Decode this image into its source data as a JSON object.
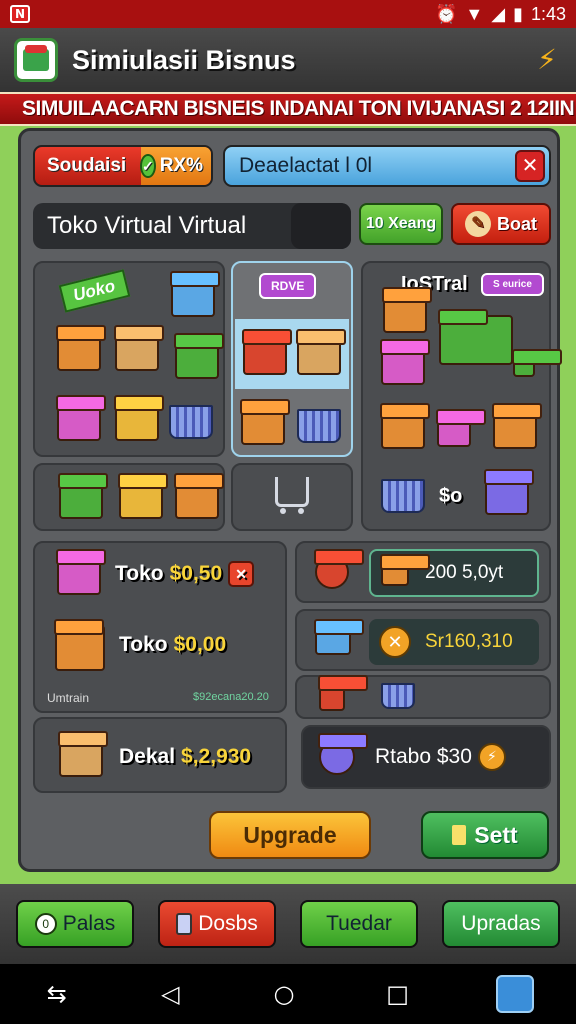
{
  "status_bar": {
    "time": "1:43",
    "icons": [
      "alarm-icon",
      "wifi-icon",
      "signal-icon",
      "battery-icon"
    ]
  },
  "header": {
    "title": "Simiulasii Bisnus",
    "banner": "SIMUILAACARN BISNEIS INDANAI TON IVIJANASI 2 12IIN"
  },
  "toolbar": {
    "red_pill_label": "Soudaisi",
    "red_pill_value": "RX%",
    "blue_field_value": "Deaelactat l 0l",
    "search_value": "Toko Virtual Virtual",
    "green_button": "10 Xeang",
    "red_button": "Boat"
  },
  "grid": {
    "ribbon_label": "Uoko",
    "sign_center": "RDVE",
    "label_right": "IoSTral",
    "sign_right": "S eurice",
    "price_small": "$o"
  },
  "lists": {
    "row1": {
      "name": "Toko",
      "amount": "$0,50"
    },
    "row2": {
      "name": "Toko",
      "amount": "$0,00"
    },
    "footer_left": "Umtrain",
    "footer_right": "$92ecana20.20",
    "row3": {
      "name": "Dekal",
      "amount": "$,2,930"
    },
    "right_value1": "200 5,0yt",
    "right_value2": "Sr160,310",
    "right_row3": "Rtabo $30"
  },
  "actions": {
    "upgrade": "Upgrade",
    "sett": "Sett"
  },
  "bottom_nav": {
    "b1": "Palas",
    "b2": "Dosbs",
    "b3": "Tuedar",
    "b4": "Upradas"
  },
  "colors": {
    "accent_red": "#a81010",
    "background": "#8fd05a",
    "panel": "#5d5f62",
    "upgrade": "#f8b22a"
  }
}
